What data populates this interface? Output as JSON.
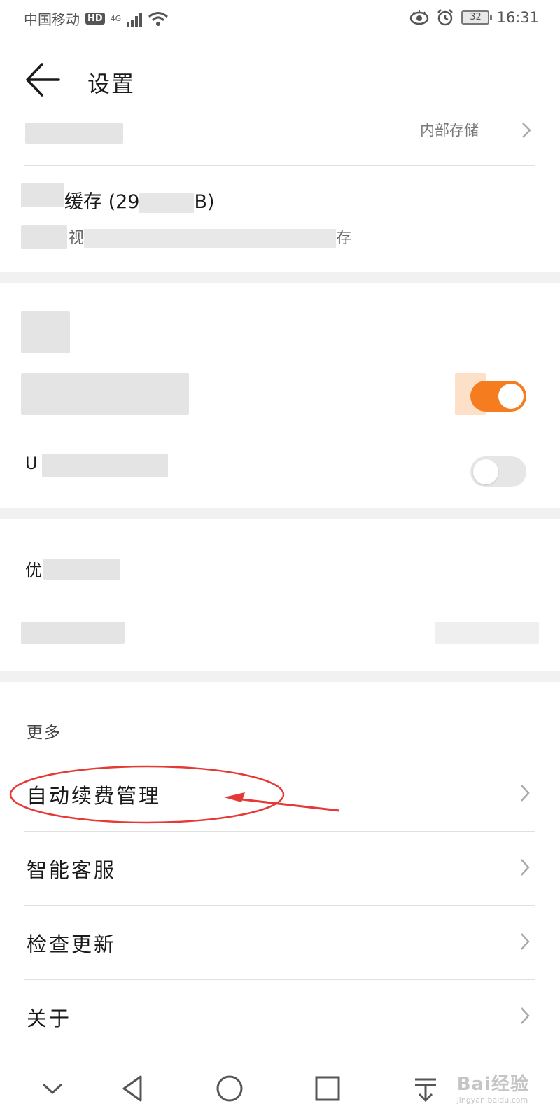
{
  "status_bar": {
    "carrier": "中国移动",
    "hd": "HD",
    "network": "4G",
    "battery": "32",
    "time": "16:31"
  },
  "header": {
    "title": "设置"
  },
  "storage": {
    "value": "内部存储"
  },
  "cache": {
    "title_visible": "缓存 (29",
    "title_suffix": "B)",
    "subtitle_visible_start": "视",
    "subtitle_visible_end": "存"
  },
  "toggles": {
    "first_on": true,
    "second_on": false
  },
  "partial_labels": {
    "u_label": "U",
    "other_label": "优"
  },
  "more": {
    "section_title": "更多",
    "items": [
      {
        "label": "自动续费管理"
      },
      {
        "label": "智能客服"
      },
      {
        "label": "检查更新"
      },
      {
        "label": "关于"
      }
    ]
  },
  "watermark": {
    "brand": "Bai经验",
    "url": "jingyan.baidu.com"
  },
  "colors": {
    "accent": "#f57c1f",
    "annotation": "#e53935"
  }
}
